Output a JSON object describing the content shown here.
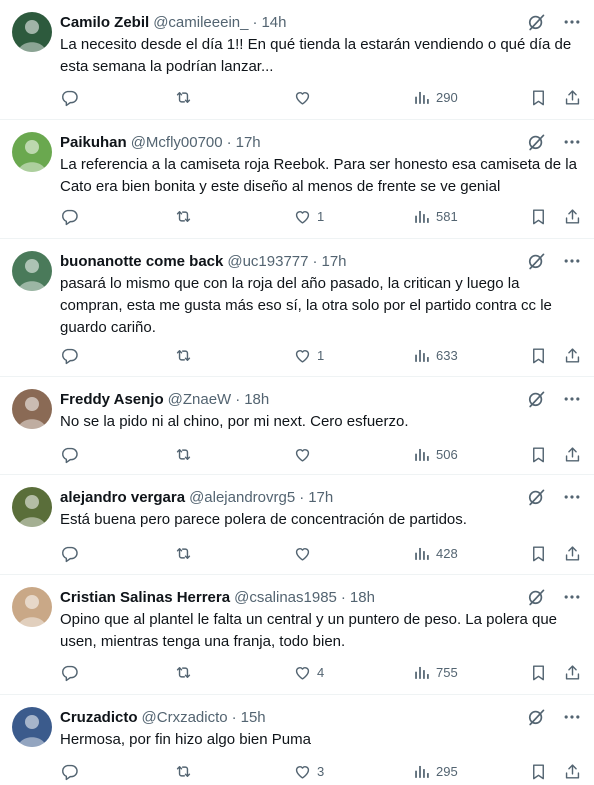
{
  "tweets": [
    {
      "name": "Camilo Zebil",
      "handle": "@camileeein_",
      "time": "14h",
      "text": "La necesito desde el día 1!! En qué tienda la estarán vendiendo o qué día de esta semana la podrían lanzar...",
      "replies": "",
      "retweets": "",
      "likes": "",
      "views": "290",
      "avatar_color": "#2d5a3d"
    },
    {
      "name": "Paikuhan",
      "handle": "@Mcfly00700",
      "time": "17h",
      "text": "La referencia a la camiseta roja Reebok. Para ser honesto esa camiseta de la Cato era bien bonita y este diseño al menos de frente se ve genial",
      "replies": "",
      "retweets": "",
      "likes": "1",
      "views": "581",
      "avatar_color": "#6aa84f"
    },
    {
      "name": "buonanotte come back",
      "handle": "@uc193777",
      "time": "17h",
      "text": "pasará lo mismo que con la roja del año pasado, la critican y luego la compran, esta me gusta más eso sí, la otra solo por el partido contra cc le guardo cariño.",
      "replies": "",
      "retweets": "",
      "likes": "1",
      "views": "633",
      "avatar_color": "#4a7a5a"
    },
    {
      "name": "Freddy Asenjo",
      "handle": "@ZnaeW",
      "time": "18h",
      "text": "No se la pido ni al chino, por mi next. Cero esfuerzo.",
      "replies": "",
      "retweets": "",
      "likes": "",
      "views": "506",
      "avatar_color": "#8a6a55"
    },
    {
      "name": "alejandro vergara",
      "handle": "@alejandrovrg5",
      "time": "17h",
      "text": "Está buena pero parece polera de concentración de partidos.",
      "replies": "",
      "retweets": "",
      "likes": "",
      "views": "428",
      "avatar_color": "#5a6e3a"
    },
    {
      "name": "Cristian Salinas Herrera",
      "handle": "@csalinas1985",
      "time": "18h",
      "text": "Opino que al plantel le falta un central y un puntero de peso. La polera que usen, mientras tenga una franja, todo bien.",
      "replies": "",
      "retweets": "",
      "likes": "4",
      "views": "755",
      "avatar_color": "#c9a887"
    },
    {
      "name": "Cruzadicto",
      "handle": "@Crxzadicto",
      "time": "15h",
      "text": "Hermosa, por fin hizo algo bien Puma",
      "replies": "",
      "retweets": "",
      "likes": "3",
      "views": "295",
      "avatar_color": "#3b5b8c"
    }
  ],
  "colors": {
    "text": "#0f1419",
    "muted": "#536471",
    "divider": "#eff3f4"
  },
  "icons": [
    "reply-icon",
    "retweet-icon",
    "like-icon",
    "views-icon",
    "bookmark-icon",
    "share-icon",
    "grok-icon",
    "more-icon"
  ]
}
